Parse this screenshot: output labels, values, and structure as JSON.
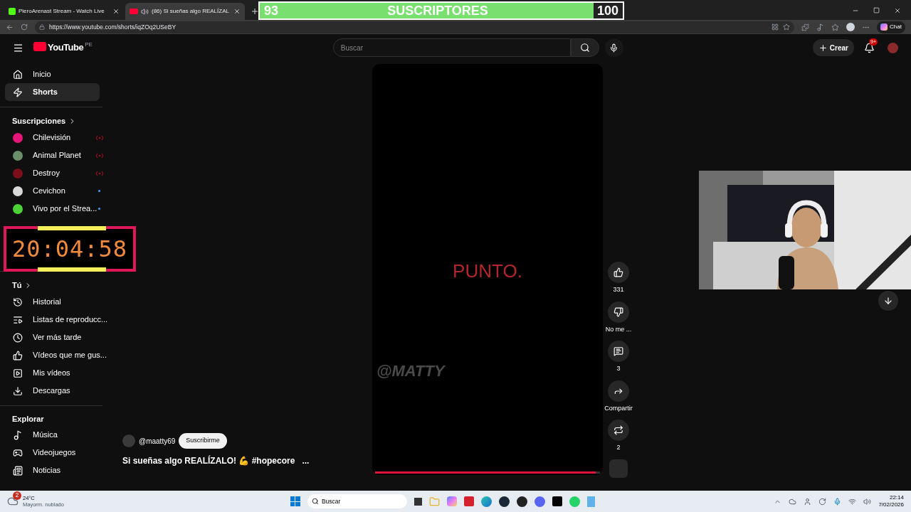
{
  "browser": {
    "tabs": [
      {
        "title": "PieroArenast Stream - Watch Live",
        "selected": false
      },
      {
        "title": "(86) Si sueñas algo REALÍZAL",
        "selected": true
      }
    ],
    "url": "https://www.youtube.com/shorts/iqZOq2USeBY",
    "chat_label": "Chat"
  },
  "subscriber_goal": {
    "current": "93",
    "label": "SUSCRIPTORES",
    "target": "100",
    "level": 0.92
  },
  "header": {
    "logo": "YouTube",
    "country": "PE",
    "search_placeholder": "Buscar",
    "create_label": "Crear",
    "notification_badge": "9+"
  },
  "sidebar": {
    "main": [
      {
        "label": "Inicio",
        "selected": false
      },
      {
        "label": "Shorts",
        "selected": true
      }
    ],
    "subscriptions_title": "Suscripciones",
    "subscriptions": [
      {
        "label": "Chilevisión",
        "color": "#e5157a",
        "live": true
      },
      {
        "label": "Animal Planet",
        "color": "#6b8e6b",
        "live": true
      },
      {
        "label": "Destroy",
        "color": "#7a0f1a",
        "live": true
      },
      {
        "label": "Cevichon",
        "color": "#d9d9d9",
        "live": false
      },
      {
        "label": "Vivo por el Strea...",
        "color": "#4cd137",
        "live": false
      }
    ],
    "you_title": "Tú",
    "you": [
      {
        "label": "Historial"
      },
      {
        "label": "Listas de reproducc..."
      },
      {
        "label": "Ver más tarde"
      },
      {
        "label": "Vídeos que me gus..."
      },
      {
        "label": "Mis vídeos"
      },
      {
        "label": "Descargas"
      }
    ],
    "explore_title": "Explorar",
    "explore": [
      {
        "label": "Música"
      },
      {
        "label": "Videojuegos"
      },
      {
        "label": "Noticias"
      }
    ]
  },
  "timer": "20:04:58",
  "short": {
    "video_text": "PUNTO.",
    "watermark": "@MATTY",
    "level": 0.98,
    "channel": "@maatty69",
    "subscribe_label": "Suscribirme",
    "title": "Si sueñas algo REALÍZALO! 💪 #hopecore",
    "more": "...",
    "actions": [
      {
        "label": "331"
      },
      {
        "label": "No me ..."
      },
      {
        "label": "3"
      },
      {
        "label": "Compartir"
      },
      {
        "label": "2"
      }
    ]
  },
  "taskbar": {
    "temperature": "24°C",
    "weather": "Mayorm. nublado",
    "weather_badge": "2",
    "search_placeholder": "Buscar",
    "time": "22:14",
    "date": "7/02/2026"
  }
}
